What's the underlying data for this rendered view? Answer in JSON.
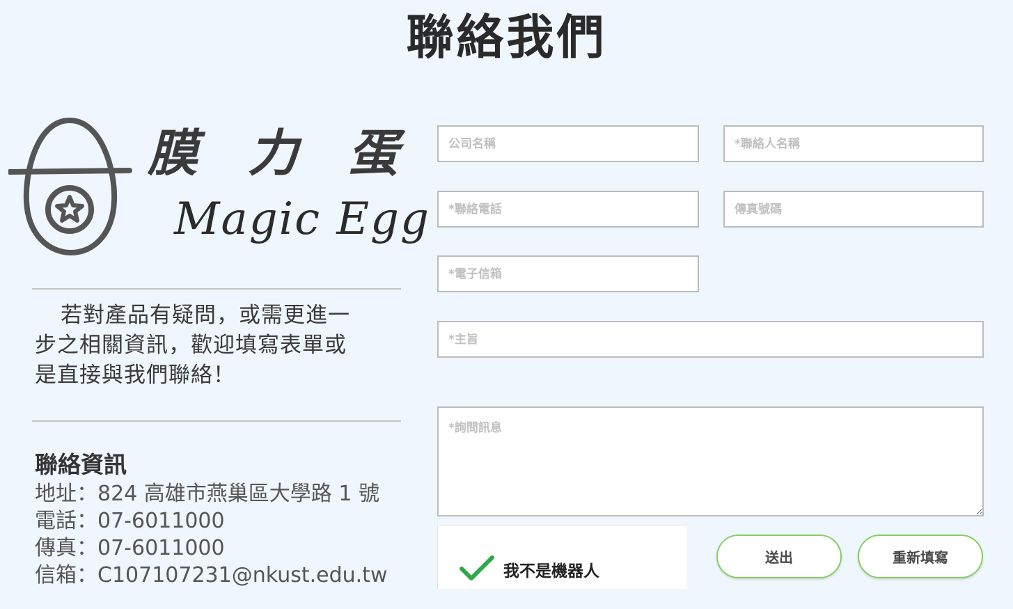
{
  "page": {
    "title": "聯絡我們"
  },
  "logo": {
    "brand_cn": [
      "膜",
      "力",
      "蛋"
    ],
    "brand_en": "Magic Egg",
    "icon": "egg-with-star-icon"
  },
  "intro": {
    "text": "若對產品有疑問，或需更進一步之相關資訊，歡迎填寫表單或是直接與我們聯絡！"
  },
  "contact": {
    "title": "聯絡資訊",
    "address": "地址：824 高雄市燕巢區大學路 1 號",
    "phone": "電話：07-6011000",
    "fax": "傳真：07-6011000",
    "email": "信箱：C107107231@nkust.edu.tw"
  },
  "form": {
    "company_placeholder": "公司名稱",
    "contact_name_placeholder": "*聯絡人名稱",
    "phone_placeholder": "*聯絡電話",
    "fax_placeholder": "傳真號碼",
    "email_placeholder": "*電子信箱",
    "subject_placeholder": "*主旨",
    "message_placeholder": "*詢問訊息",
    "captcha_label": "我不是機器人",
    "captcha_icon": "checkmark-icon",
    "submit_label": "送出",
    "reset_label": "重新填寫"
  },
  "colors": {
    "background": "#f0f6fd",
    "button_border": "#86cf62",
    "checkmark": "#2fa84a"
  }
}
